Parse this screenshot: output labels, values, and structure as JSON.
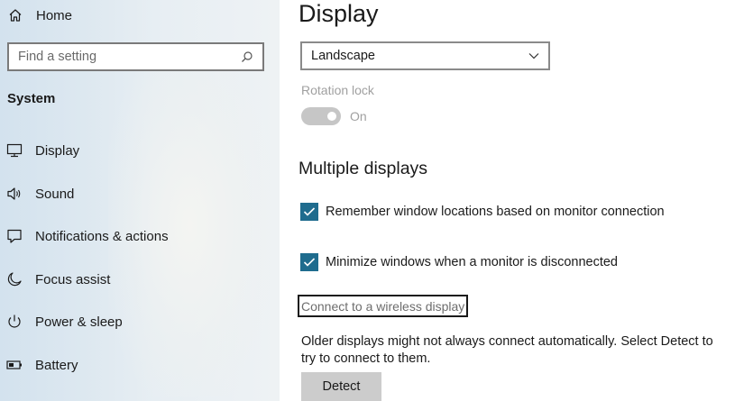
{
  "sidebar": {
    "home": {
      "label": "Home",
      "icon": "home-icon"
    },
    "search": {
      "placeholder": "Find a setting",
      "icon": "search-icon"
    },
    "section_title": "System",
    "items": [
      {
        "label": "Display",
        "icon": "monitor-icon"
      },
      {
        "label": "Sound",
        "icon": "speaker-icon"
      },
      {
        "label": "Notifications & actions",
        "icon": "message-icon"
      },
      {
        "label": "Focus assist",
        "icon": "moon-icon"
      },
      {
        "label": "Power & sleep",
        "icon": "power-icon"
      },
      {
        "label": "Battery",
        "icon": "battery-icon"
      }
    ]
  },
  "main": {
    "title": "Display",
    "orientation": {
      "value": "Landscape",
      "icon": "chevron-down-icon"
    },
    "rotation_lock": {
      "label": "Rotation lock",
      "state": "On",
      "enabled": false,
      "on": true
    },
    "multiple_displays": {
      "heading": "Multiple displays",
      "options": [
        {
          "label": "Remember window locations based on monitor connection",
          "checked": true
        },
        {
          "label": "Minimize windows when a monitor is disconnected",
          "checked": true
        }
      ],
      "wireless_link": "Connect to a wireless display",
      "info": "Older displays might not always connect automatically. Select Detect to try to connect to them.",
      "detect_button": "Detect"
    }
  },
  "colors": {
    "accent": "#1f6c8e",
    "toggle_disabled": "#c6c6c6",
    "button_bg": "#cccccc"
  }
}
